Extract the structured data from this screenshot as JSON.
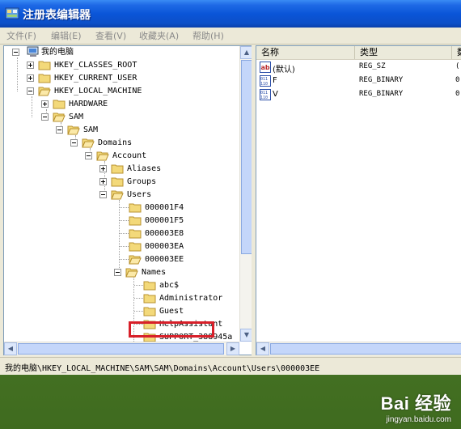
{
  "window": {
    "title": "注册表编辑器"
  },
  "menu": [
    "文件(F)",
    "编辑(E)",
    "查看(V)",
    "收藏夹(A)",
    "帮助(H)"
  ],
  "tree": {
    "root": "我的电脑",
    "nodes": [
      "HKEY_CLASSES_ROOT",
      "HKEY_CURRENT_USER",
      "HKEY_LOCAL_MACHINE",
      "HARDWARE",
      "SAM",
      "SAM",
      "Domains",
      "Account",
      "Aliases",
      "Groups",
      "Users",
      "000001F4",
      "000001F5",
      "000003E8",
      "000003EA",
      "000003EE",
      "Names",
      "abc$",
      "Administrator",
      "Guest",
      "HelpAssistant",
      "SUPPORT_388945a"
    ]
  },
  "list": {
    "columns": [
      "名称",
      "类型",
      "数"
    ],
    "rows": [
      {
        "name": "(默认)",
        "type": "REG_SZ",
        "data": "(",
        "icon": "string-value-icon"
      },
      {
        "name": "F",
        "type": "REG_BINARY",
        "data": "0",
        "icon": "binary-value-icon"
      },
      {
        "name": "V",
        "type": "REG_BINARY",
        "data": "0",
        "icon": "binary-value-icon"
      }
    ]
  },
  "status": "我的电脑\\HKEY_LOCAL_MACHINE\\SAM\\SAM\\Domains\\Account\\Users\\000003EE",
  "watermark": {
    "brand": "Bai 经验",
    "url": "jingyan.baidu.com"
  },
  "colors": {
    "titlebar": "#0a55d8",
    "highlight": "#d8202a",
    "folder": "#f3d97a"
  }
}
